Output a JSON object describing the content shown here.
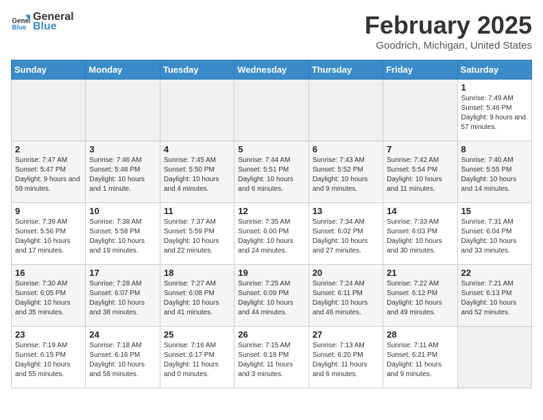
{
  "logo": {
    "text_general": "General",
    "text_blue": "Blue"
  },
  "header": {
    "month": "February 2025",
    "location": "Goodrich, Michigan, United States"
  },
  "weekdays": [
    "Sunday",
    "Monday",
    "Tuesday",
    "Wednesday",
    "Thursday",
    "Friday",
    "Saturday"
  ],
  "weeks": [
    [
      {
        "day": "",
        "info": ""
      },
      {
        "day": "",
        "info": ""
      },
      {
        "day": "",
        "info": ""
      },
      {
        "day": "",
        "info": ""
      },
      {
        "day": "",
        "info": ""
      },
      {
        "day": "",
        "info": ""
      },
      {
        "day": "1",
        "info": "Sunrise: 7:49 AM\nSunset: 5:46 PM\nDaylight: 9 hours and 57 minutes."
      }
    ],
    [
      {
        "day": "2",
        "info": "Sunrise: 7:47 AM\nSunset: 5:47 PM\nDaylight: 9 hours and 59 minutes."
      },
      {
        "day": "3",
        "info": "Sunrise: 7:46 AM\nSunset: 5:48 PM\nDaylight: 10 hours and 1 minute."
      },
      {
        "day": "4",
        "info": "Sunrise: 7:45 AM\nSunset: 5:50 PM\nDaylight: 10 hours and 4 minutes."
      },
      {
        "day": "5",
        "info": "Sunrise: 7:44 AM\nSunset: 5:51 PM\nDaylight: 10 hours and 6 minutes."
      },
      {
        "day": "6",
        "info": "Sunrise: 7:43 AM\nSunset: 5:52 PM\nDaylight: 10 hours and 9 minutes."
      },
      {
        "day": "7",
        "info": "Sunrise: 7:42 AM\nSunset: 5:54 PM\nDaylight: 10 hours and 11 minutes."
      },
      {
        "day": "8",
        "info": "Sunrise: 7:40 AM\nSunset: 5:55 PM\nDaylight: 10 hours and 14 minutes."
      }
    ],
    [
      {
        "day": "9",
        "info": "Sunrise: 7:39 AM\nSunset: 5:56 PM\nDaylight: 10 hours and 17 minutes."
      },
      {
        "day": "10",
        "info": "Sunrise: 7:38 AM\nSunset: 5:58 PM\nDaylight: 10 hours and 19 minutes."
      },
      {
        "day": "11",
        "info": "Sunrise: 7:37 AM\nSunset: 5:59 PM\nDaylight: 10 hours and 22 minutes."
      },
      {
        "day": "12",
        "info": "Sunrise: 7:35 AM\nSunset: 6:00 PM\nDaylight: 10 hours and 24 minutes."
      },
      {
        "day": "13",
        "info": "Sunrise: 7:34 AM\nSunset: 6:02 PM\nDaylight: 10 hours and 27 minutes."
      },
      {
        "day": "14",
        "info": "Sunrise: 7:33 AM\nSunset: 6:03 PM\nDaylight: 10 hours and 30 minutes."
      },
      {
        "day": "15",
        "info": "Sunrise: 7:31 AM\nSunset: 6:04 PM\nDaylight: 10 hours and 33 minutes."
      }
    ],
    [
      {
        "day": "16",
        "info": "Sunrise: 7:30 AM\nSunset: 6:05 PM\nDaylight: 10 hours and 35 minutes."
      },
      {
        "day": "17",
        "info": "Sunrise: 7:28 AM\nSunset: 6:07 PM\nDaylight: 10 hours and 38 minutes."
      },
      {
        "day": "18",
        "info": "Sunrise: 7:27 AM\nSunset: 6:08 PM\nDaylight: 10 hours and 41 minutes."
      },
      {
        "day": "19",
        "info": "Sunrise: 7:25 AM\nSunset: 6:09 PM\nDaylight: 10 hours and 44 minutes."
      },
      {
        "day": "20",
        "info": "Sunrise: 7:24 AM\nSunset: 6:11 PM\nDaylight: 10 hours and 46 minutes."
      },
      {
        "day": "21",
        "info": "Sunrise: 7:22 AM\nSunset: 6:12 PM\nDaylight: 10 hours and 49 minutes."
      },
      {
        "day": "22",
        "info": "Sunrise: 7:21 AM\nSunset: 6:13 PM\nDaylight: 10 hours and 52 minutes."
      }
    ],
    [
      {
        "day": "23",
        "info": "Sunrise: 7:19 AM\nSunset: 6:15 PM\nDaylight: 10 hours and 55 minutes."
      },
      {
        "day": "24",
        "info": "Sunrise: 7:18 AM\nSunset: 6:16 PM\nDaylight: 10 hours and 58 minutes."
      },
      {
        "day": "25",
        "info": "Sunrise: 7:16 AM\nSunset: 6:17 PM\nDaylight: 11 hours and 0 minutes."
      },
      {
        "day": "26",
        "info": "Sunrise: 7:15 AM\nSunset: 6:18 PM\nDaylight: 11 hours and 3 minutes."
      },
      {
        "day": "27",
        "info": "Sunrise: 7:13 AM\nSunset: 6:20 PM\nDaylight: 11 hours and 6 minutes."
      },
      {
        "day": "28",
        "info": "Sunrise: 7:11 AM\nSunset: 6:21 PM\nDaylight: 11 hours and 9 minutes."
      },
      {
        "day": "",
        "info": ""
      }
    ]
  ]
}
